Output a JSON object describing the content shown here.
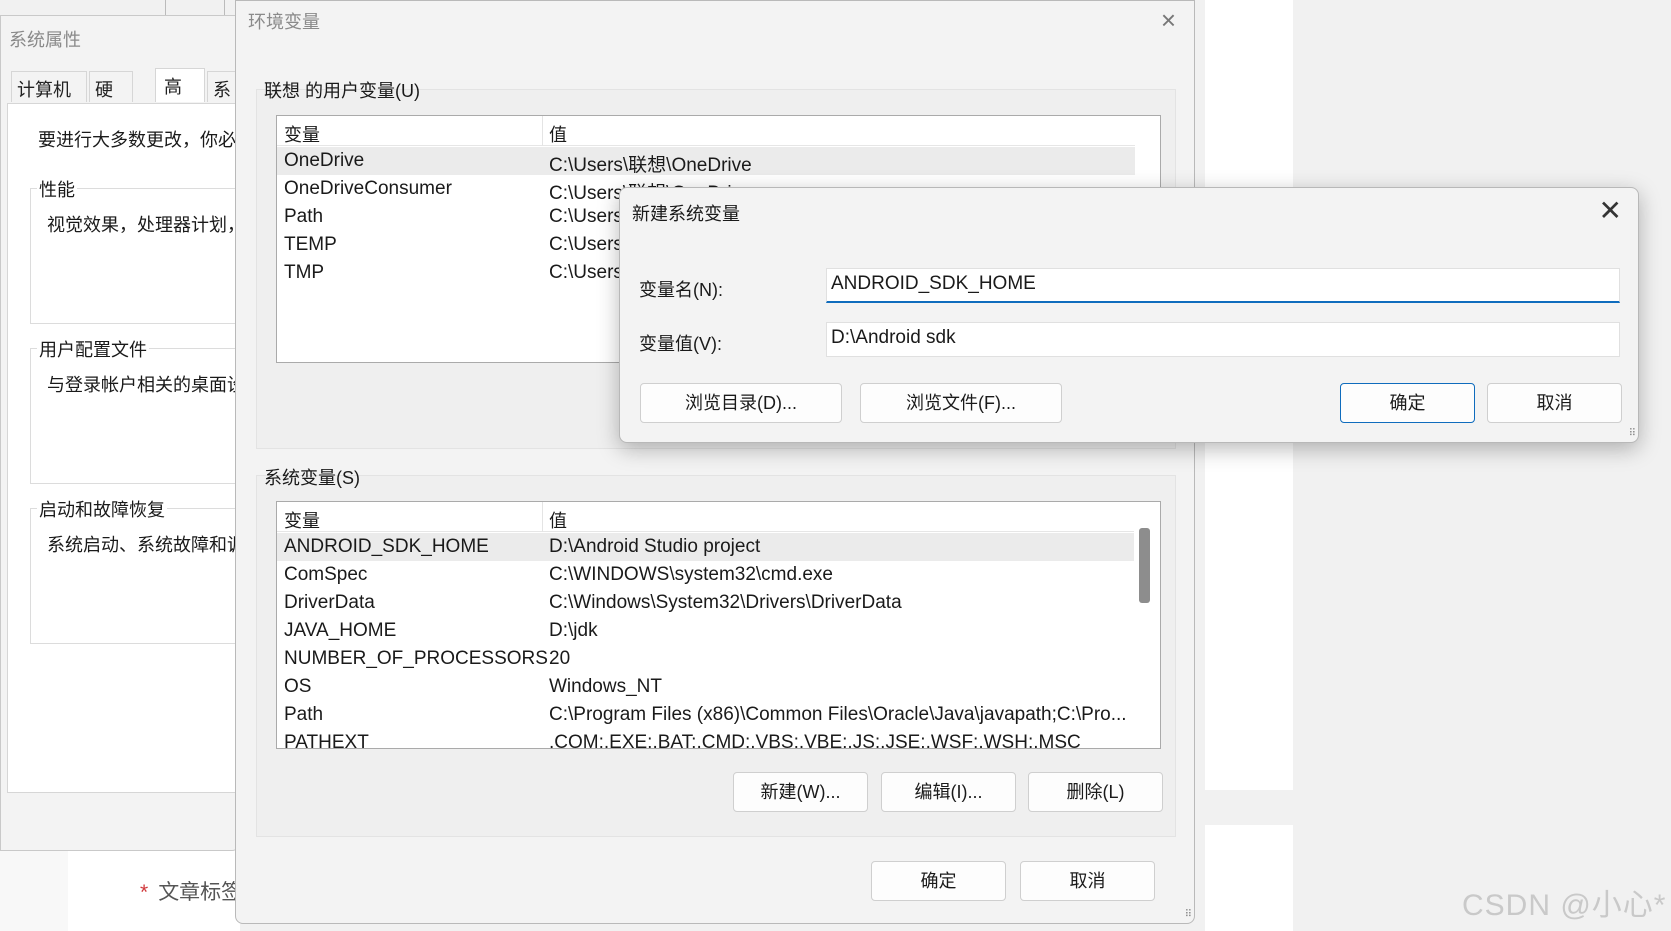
{
  "background": {
    "article_tag_star": "*",
    "article_tag": "文章标签",
    "watermark": "CSDN @小心*"
  },
  "system_properties": {
    "title": "系统属性",
    "tabs": [
      "计算机名",
      "硬件",
      "高级",
      "系"
    ],
    "active_tab": "高级",
    "intro": "要进行大多数更改，你必",
    "groups": [
      {
        "title": "性能",
        "desc": "视觉效果，处理器计划，"
      },
      {
        "title": "用户配置文件",
        "desc": "与登录帐户相关的桌面设"
      },
      {
        "title": "启动和故障恢复",
        "desc": "系统启动、系统故障和调"
      }
    ]
  },
  "env_vars": {
    "title": "环境变量",
    "close_glyph": "×",
    "user_section_label": "联想 的用户变量(U)",
    "system_section_label": "系统变量(S)",
    "col_var": "变量",
    "col_value": "值",
    "user_vars": [
      {
        "name": "OneDrive",
        "value": "C:\\Users\\联想\\OneDrive",
        "selected": true
      },
      {
        "name": "OneDriveConsumer",
        "value": "C:\\Users\\联想\\OneDrive"
      },
      {
        "name": "Path",
        "value": "C:\\Users\\"
      },
      {
        "name": "TEMP",
        "value": "C:\\Users\\"
      },
      {
        "name": "TMP",
        "value": "C:\\Users\\"
      }
    ],
    "system_vars": [
      {
        "name": "ANDROID_SDK_HOME",
        "value": "D:\\Android Studio project",
        "selected": true
      },
      {
        "name": "ComSpec",
        "value": "C:\\WINDOWS\\system32\\cmd.exe"
      },
      {
        "name": "DriverData",
        "value": "C:\\Windows\\System32\\Drivers\\DriverData"
      },
      {
        "name": "JAVA_HOME",
        "value": "D:\\jdk"
      },
      {
        "name": "NUMBER_OF_PROCESSORS",
        "value": "20"
      },
      {
        "name": "OS",
        "value": "Windows_NT"
      },
      {
        "name": "Path",
        "value": "C:\\Program Files (x86)\\Common Files\\Oracle\\Java\\javapath;C:\\Pro..."
      },
      {
        "name": "PATHEXT",
        "value": ".COM;.EXE;.BAT;.CMD;.VBS;.VBE;.JS;.JSE;.WSF;.WSH;.MSC"
      }
    ],
    "new_button": "新建(W)...",
    "edit_button": "编辑(I)...",
    "delete_button": "删除(L)",
    "ok_button": "确定",
    "cancel_button": "取消"
  },
  "new_var_dialog": {
    "title": "新建系统变量",
    "close_glyph": "✕",
    "name_label": "变量名(N):",
    "name_value": "ANDROID_SDK_HOME",
    "value_label": "变量值(V):",
    "value_value": "D:\\Android sdk",
    "browse_dir_button": "浏览目录(D)...",
    "browse_file_button": "浏览文件(F)...",
    "ok_button": "确定",
    "cancel_button": "取消"
  }
}
